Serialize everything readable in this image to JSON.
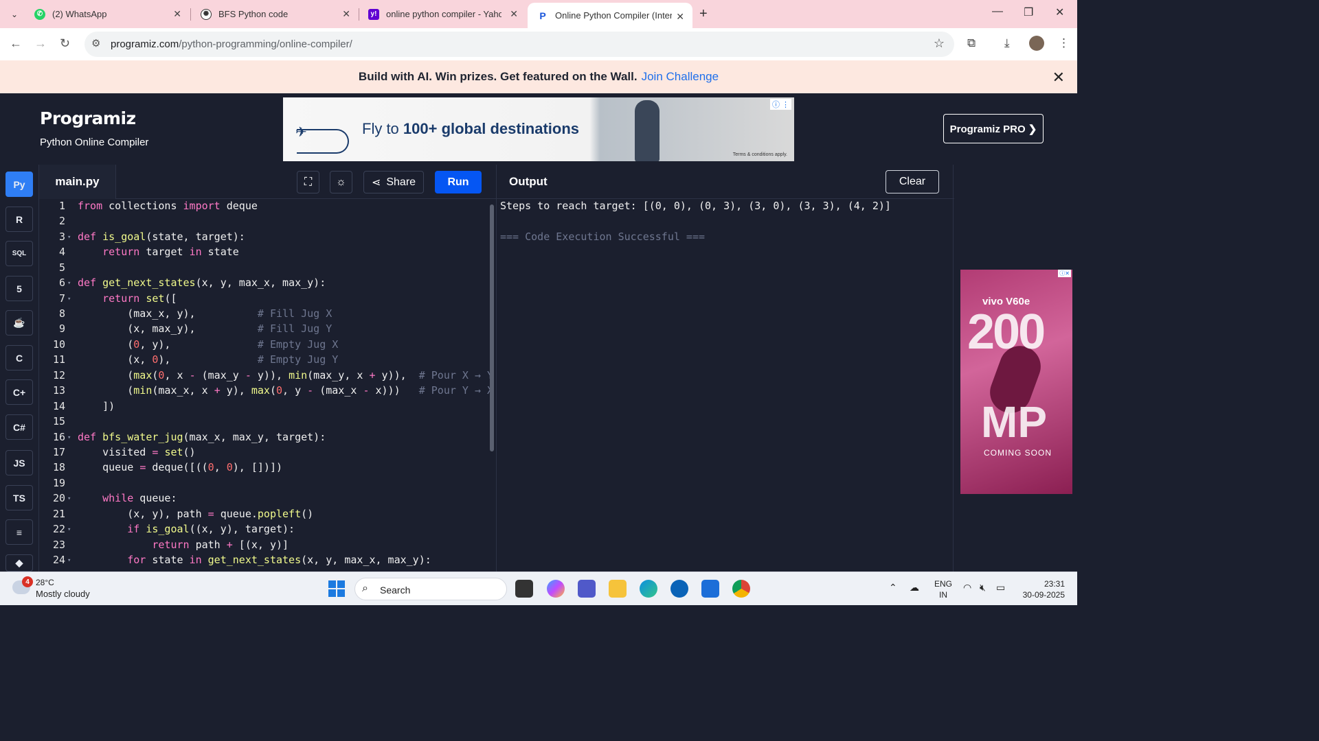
{
  "browser": {
    "tabs": [
      {
        "title": "(2) WhatsApp",
        "favicon": "whatsapp-icon",
        "color": "#25D366"
      },
      {
        "title": "BFS Python code",
        "favicon": "openai-icon",
        "color": "#333333"
      },
      {
        "title": "online python compiler - Yahoo",
        "favicon": "yahoo-icon",
        "color": "#6001d2"
      },
      {
        "title": "Online Python Compiler (Interpreter)",
        "favicon": "programiz-icon",
        "color": "#1b1f2e"
      }
    ],
    "url_domain": "programiz.com",
    "url_path": "/python-programming/online-compiler/"
  },
  "promo": {
    "text": "Build with AI. Win prizes. Get featured on the Wall.",
    "link": "Join Challenge"
  },
  "header": {
    "logo": "Programiz",
    "subtitle": "Python Online Compiler",
    "pro_button": "Programiz PRO ❯",
    "ad_text_prefix": "Fly to ",
    "ad_text_bold": "100+ global destinations",
    "ad_terms": "Terms & conditions apply."
  },
  "sidebar": {
    "languages": [
      {
        "name": "python-icon",
        "label": "Py",
        "active": true
      },
      {
        "name": "r-icon",
        "label": "R"
      },
      {
        "name": "sql-icon",
        "label": "SQL"
      },
      {
        "name": "html-icon",
        "label": "5"
      },
      {
        "name": "java-icon",
        "label": "☕"
      },
      {
        "name": "c-icon",
        "label": "C"
      },
      {
        "name": "cpp-icon",
        "label": "C+"
      },
      {
        "name": "csharp-icon",
        "label": "C#"
      },
      {
        "name": "js-icon",
        "label": "JS"
      },
      {
        "name": "ts-icon",
        "label": "TS"
      },
      {
        "name": "go-icon",
        "label": "≡"
      },
      {
        "name": "php-icon",
        "label": "◆"
      }
    ]
  },
  "editor": {
    "filename": "main.py",
    "share_label": "Share",
    "run_label": "Run",
    "lines": [
      "1",
      "2",
      "3",
      "4",
      "5",
      "6",
      "7",
      "8",
      "9",
      "10",
      "11",
      "12",
      "13",
      "14",
      "15",
      "16",
      "17",
      "18",
      "19",
      "20",
      "21",
      "22",
      "23",
      "24"
    ]
  },
  "output": {
    "title": "Output",
    "clear_label": "Clear",
    "result": "Steps to reach target: [(0, 0), (0, 3), (3, 0), (3, 3), (4, 2)]",
    "status": "=== Code Execution Successful ==="
  },
  "ad2": {
    "brand": "vivo V60e",
    "big": "200",
    "mp": "MP",
    "soon": "COMING SOON"
  },
  "taskbar": {
    "weather_badge": "4",
    "temp": "28°C",
    "weather": "Mostly cloudy",
    "search_label": "Search",
    "lang_top": "ENG",
    "lang_bottom": "IN",
    "time": "23:31",
    "date": "30-09-2025"
  }
}
